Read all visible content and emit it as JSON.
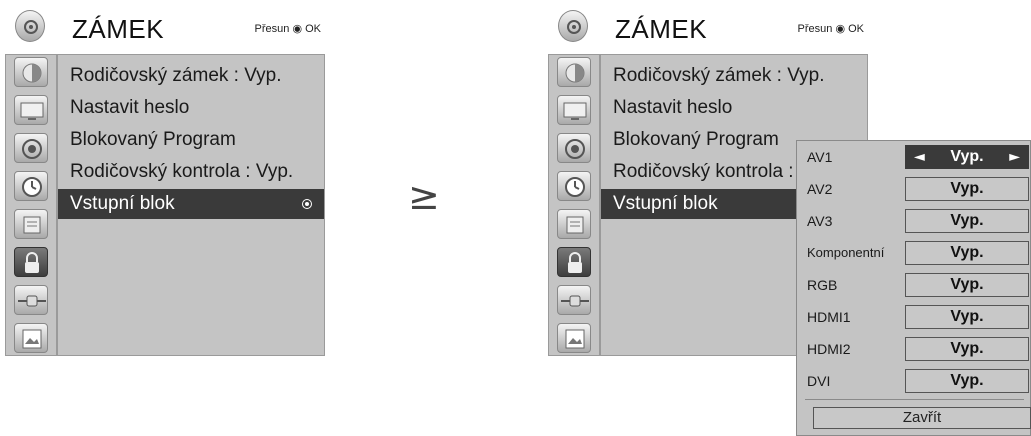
{
  "menu": {
    "title": "ZÁMEK",
    "hint": "Přesun ◉ OK",
    "items": [
      {
        "label": "Rodičovský zámek   : Vyp."
      },
      {
        "label": "Nastavit heslo"
      },
      {
        "label": "Blokovaný Program"
      },
      {
        "label": "Rodičovský kontrola : Vyp."
      },
      {
        "label": "Vstupní blok"
      }
    ],
    "items_right": [
      {
        "label": "Rodičovský zámek   : Vyp."
      },
      {
        "label": "Nastavit heslo"
      },
      {
        "label": "Blokovaný Program"
      },
      {
        "label": "Rodičovský kontrola :"
      },
      {
        "label": "Vstupní blok"
      }
    ],
    "selected_index": 4
  },
  "sidebar_icons": [
    "setup-icon",
    "picture-icon",
    "audio-icon",
    "time-icon",
    "option-icon",
    "lock-icon",
    "input-icon",
    "photo-icon"
  ],
  "transition_arrow": "≥",
  "input_block": {
    "rows": [
      {
        "label": "AV1",
        "value": "Vyp."
      },
      {
        "label": "AV2",
        "value": "Vyp."
      },
      {
        "label": "AV3",
        "value": "Vyp."
      },
      {
        "label": "Komponentní",
        "value": "Vyp."
      },
      {
        "label": "RGB",
        "value": "Vyp."
      },
      {
        "label": "HDMI1",
        "value": "Vyp."
      },
      {
        "label": "HDMI2",
        "value": "Vyp."
      },
      {
        "label": "DVI",
        "value": "Vyp."
      }
    ],
    "close_label": "Zavřít",
    "left_arrow": "◄",
    "right_arrow": "►"
  },
  "colors": {
    "panel": "#c4c4c4",
    "selected": "#3a3a3a"
  }
}
